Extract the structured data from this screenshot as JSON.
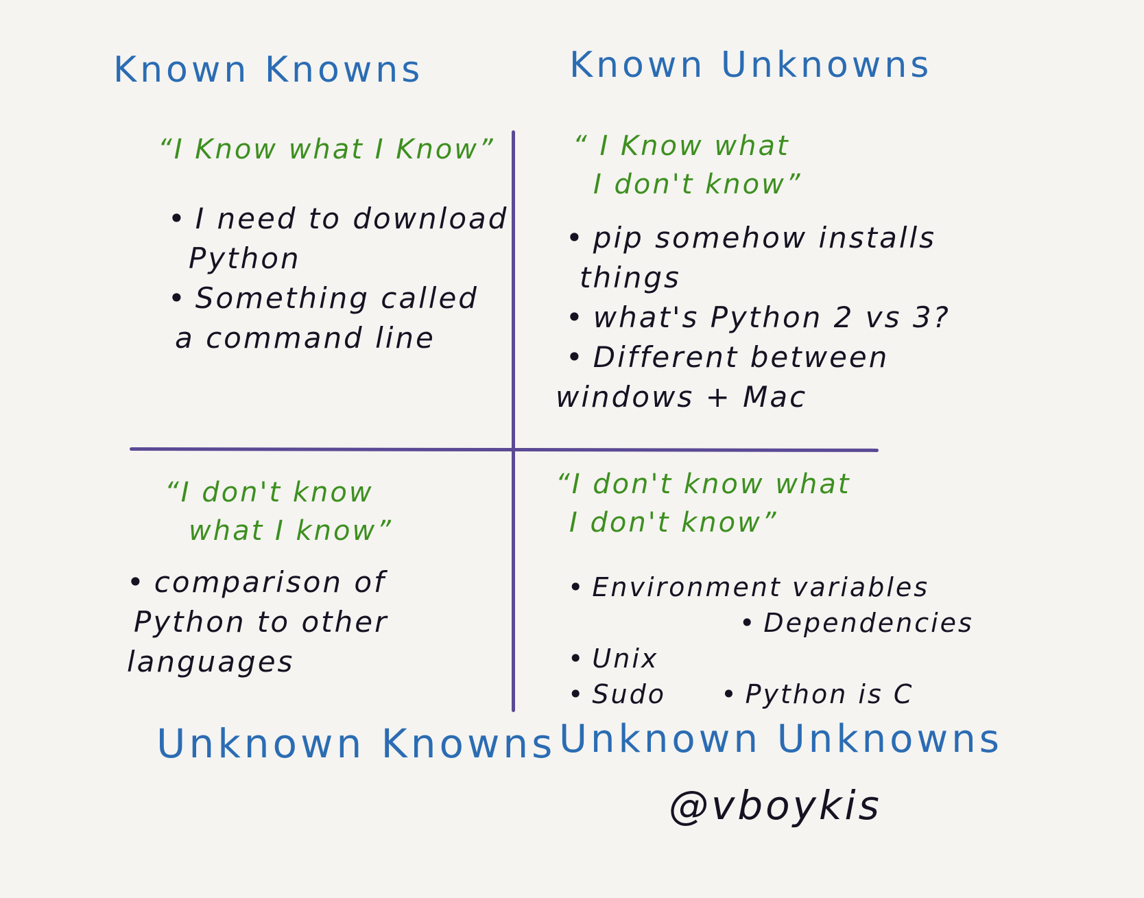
{
  "quadrants": {
    "top_left": {
      "title": "Known Knowns",
      "phrase": "“I Know what I Know”",
      "items": [
        [
          "I need to download",
          "Python"
        ],
        [
          "Something called",
          "a command line"
        ]
      ]
    },
    "top_right": {
      "title": "Known Unknowns",
      "phrase_lines": [
        "“ I Know what",
        "I don't know”"
      ],
      "items": [
        [
          "pip somehow installs",
          "things"
        ],
        [
          "what's Python 2 vs 3?"
        ],
        [
          "Different between",
          "windows + Mac"
        ]
      ]
    },
    "bottom_left": {
      "title": "Unknown Knowns",
      "phrase_lines": [
        "“I don't know",
        "what I know”"
      ],
      "items": [
        [
          "comparison of",
          "Python to other",
          "languages"
        ]
      ]
    },
    "bottom_right": {
      "title": "Unknown Unknowns",
      "phrase_lines": [
        "“I don't know what",
        "I don't know”"
      ],
      "items": [
        "Environment variables",
        "Dependencies",
        "Unix",
        "Sudo",
        "Python is C"
      ]
    }
  },
  "signature": "@vboykis",
  "colors": {
    "background": "#f5f4f1",
    "title": "#2b6cb3",
    "phrase": "#3d8f1f",
    "note": "#151322",
    "axis": "#5a4a94"
  }
}
